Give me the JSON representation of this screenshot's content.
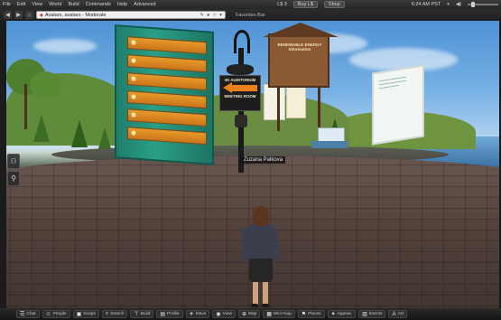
{
  "menu": {
    "items": [
      "File",
      "Edit",
      "View",
      "World",
      "Build",
      "Commands",
      "Help",
      "Advanced"
    ],
    "balance": "L$ 3",
    "buy_label": "Buy L$",
    "shop_label": "Shop",
    "time": "6:24 AM PST"
  },
  "nav": {
    "location": "Avatars, avatars - Moderate",
    "favorites_label": "Favorites Bar"
  },
  "scene": {
    "board_rows": [
      "",
      "",
      "",
      "",
      "",
      ""
    ],
    "sign_top": "3D AUDITORIUM",
    "sign_bottom": "MEETING ROOM",
    "treehouse_label": "RENEWABLE ENERGY Information",
    "avatar_name": "Zuzana Palkova"
  },
  "bottom_toolbar": [
    {
      "icon": "chat-icon",
      "glyph": "☰",
      "label": "Chat"
    },
    {
      "icon": "people-icon",
      "glyph": "☺",
      "label": "People"
    },
    {
      "icon": "snapshot-icon",
      "glyph": "▣",
      "label": "Snaps"
    },
    {
      "icon": "search-icon",
      "glyph": "⌕",
      "label": "Search"
    },
    {
      "icon": "build-icon",
      "glyph": "⊤",
      "label": "Build"
    },
    {
      "icon": "profile-icon",
      "glyph": "▤",
      "label": "Profile"
    },
    {
      "icon": "move-icon",
      "glyph": "✈",
      "label": "Move"
    },
    {
      "icon": "view-icon",
      "glyph": "◉",
      "label": "View"
    },
    {
      "icon": "map-icon",
      "glyph": "⊕",
      "label": "Map"
    },
    {
      "icon": "mini-map-icon",
      "glyph": "▦",
      "label": "Mini-map"
    },
    {
      "icon": "places-icon",
      "glyph": "⚑",
      "label": "Places"
    },
    {
      "icon": "appearance-icon",
      "glyph": "✦",
      "label": "Appear."
    },
    {
      "icon": "events-icon",
      "glyph": "▥",
      "label": "Events"
    },
    {
      "icon": "text-size-icon",
      "glyph": "A",
      "label": "AO"
    }
  ]
}
